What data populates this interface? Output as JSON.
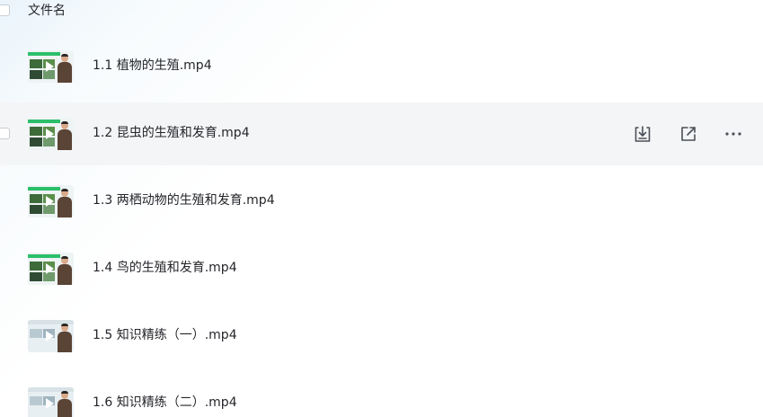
{
  "header": {
    "column_label": "文件名"
  },
  "files": [
    {
      "name": "1.1 植物的生殖.mp4"
    },
    {
      "name": "1.2 昆虫的生殖和发育.mp4"
    },
    {
      "name": "1.3 两栖动物的生殖和发育.mp4"
    },
    {
      "name": "1.4 鸟的生殖和发育.mp4"
    },
    {
      "name": "1.5 知识精练（一）.mp4"
    },
    {
      "name": "1.6 知识精练（二）.mp4"
    }
  ],
  "row_actions": {
    "icons": [
      "download-icon",
      "share-icon",
      "more-icon"
    ]
  },
  "colors": {
    "hover_row": "#f4f5f6",
    "text": "#25262b",
    "icon": "#4b4f57",
    "thumb_accent": "#2bbf6a"
  }
}
